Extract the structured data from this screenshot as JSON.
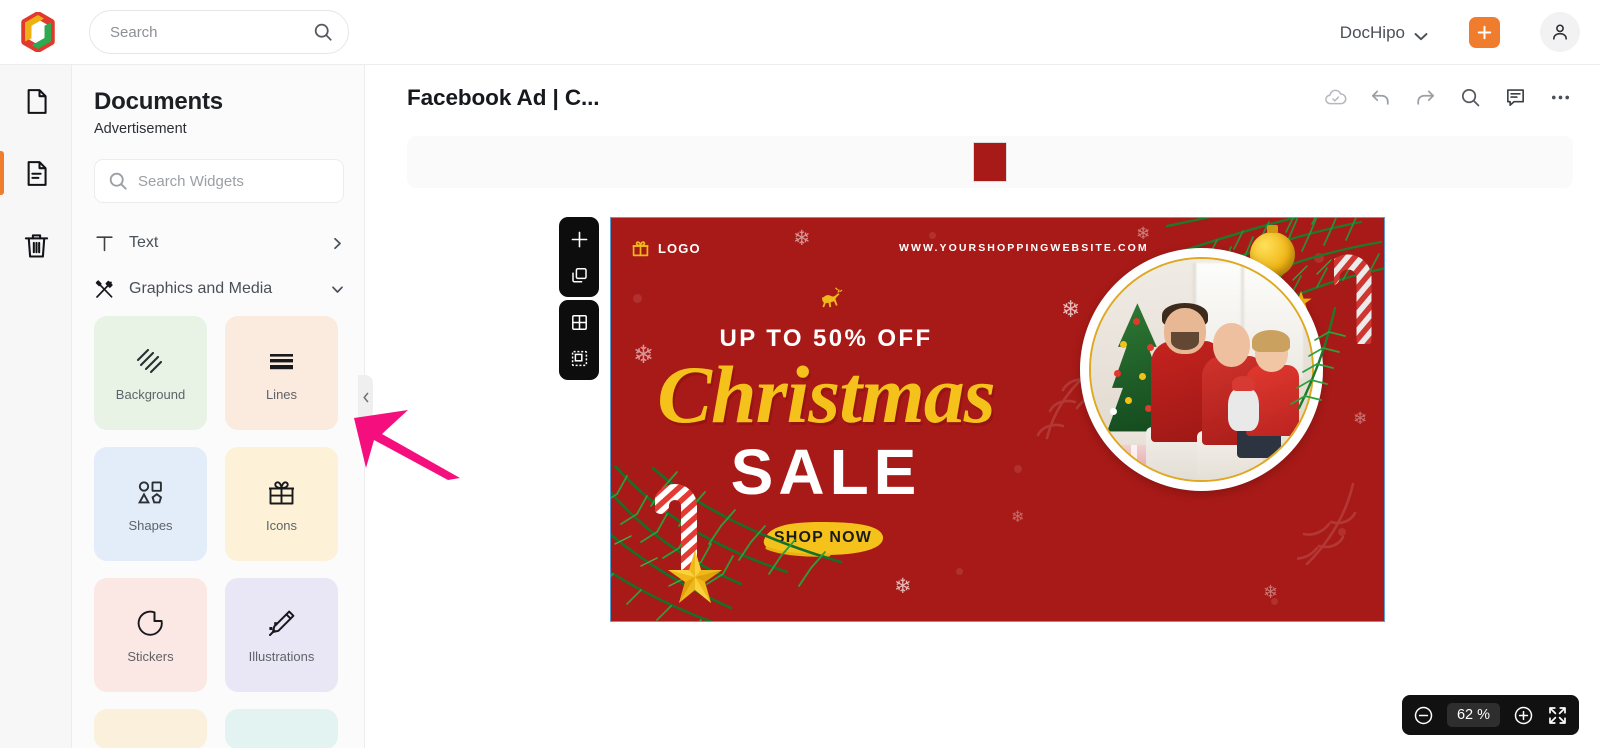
{
  "app": {
    "brand_icon": "dochipo-logo-icon",
    "account_label": "DocHipo",
    "account_chevron_icon": "chevron-down-icon",
    "create_button_icon": "plus-icon",
    "avatar_icon": "user-avatar-icon"
  },
  "search": {
    "placeholder": "Search",
    "value": "",
    "icon": "search-icon"
  },
  "rail": {
    "items": [
      {
        "name": "blank-page",
        "icon": "blank-page-icon",
        "active": false
      },
      {
        "name": "documents",
        "icon": "document-lines-icon",
        "active": true
      },
      {
        "name": "trash",
        "icon": "trash-icon",
        "active": false
      }
    ]
  },
  "panel": {
    "title": "Documents",
    "subtitle": "Advertisement",
    "widget_search": {
      "placeholder": "Search Widgets",
      "value": "",
      "icon": "search-icon"
    },
    "categories": [
      {
        "label": "Text",
        "icon": "text-t-icon",
        "arrow": "chevron-right-icon",
        "expanded": false
      },
      {
        "label": "Graphics and Media",
        "icon": "graphics-media-icon",
        "arrow": "chevron-down-icon",
        "expanded": true
      }
    ],
    "tiles": [
      {
        "label": "Background",
        "icon": "hatch-pattern-icon",
        "bg": "#e8f3e6",
        "partial": false
      },
      {
        "label": "Lines",
        "icon": "horizontal-lines-icon",
        "bg": "#fbeade",
        "partial": false
      },
      {
        "label": "Shapes",
        "icon": "shapes-icon",
        "bg": "#e3edfa",
        "partial": false
      },
      {
        "label": "Icons",
        "icon": "gift-box-icon",
        "bg": "#fdf2d8",
        "partial": false
      },
      {
        "label": "Stickers",
        "icon": "sticker-icon",
        "bg": "#fbe7e4",
        "partial": false
      },
      {
        "label": "Illustrations",
        "icon": "pencil-ruler-icon",
        "bg": "#e9e7f5",
        "partial": false
      },
      {
        "label": "",
        "icon": "",
        "bg": "#fbf0dc",
        "partial": true
      },
      {
        "label": "",
        "icon": "",
        "bg": "#e2f3f1",
        "partial": true
      }
    ],
    "collapse_icon": "chevron-left-icon"
  },
  "document": {
    "title": "Facebook Ad | C...",
    "tools": [
      {
        "name": "cloud-saved",
        "icon": "cloud-check-icon"
      },
      {
        "name": "undo",
        "icon": "undo-arrow-icon"
      },
      {
        "name": "redo",
        "icon": "redo-arrow-icon"
      },
      {
        "name": "find",
        "icon": "search-icon"
      },
      {
        "name": "comments",
        "icon": "comment-icon"
      },
      {
        "name": "more",
        "icon": "ellipsis-icon"
      }
    ],
    "pages": [
      {
        "index": 1,
        "selected": true,
        "color": "#a71a18"
      }
    ]
  },
  "canvas_toolbars": [
    {
      "name": "add-duplicate-toolbar",
      "buttons": [
        {
          "name": "add-page",
          "icon": "plus-icon"
        },
        {
          "name": "duplicate-page",
          "icon": "duplicate-icon"
        }
      ]
    },
    {
      "name": "grid-crop-toolbar",
      "buttons": [
        {
          "name": "grid-view",
          "icon": "grid-four-icon"
        },
        {
          "name": "crop-select",
          "icon": "crop-dashed-icon"
        }
      ]
    }
  ],
  "design": {
    "background_color": "#a81a17",
    "gold_color": "#f5c21b",
    "logo_label": "LOGO",
    "logo_icon": "gift-box-icon",
    "website_url": "WWW.YOURSHOPPINGWEBSITE.COM",
    "reindeer_icon": "reindeer-icon",
    "offer_text": "UP TO 50% OFF",
    "headline_script": "Christmas",
    "headline_bold": "SALE",
    "cta_label": "SHOP NOW",
    "photo_alt": "family-christmas-photo",
    "decorations": [
      "pine-branch-top-right",
      "gold-bauble-ornament",
      "candy-cane-top-right",
      "gold-star-top-right",
      "pine-branch-bottom-left",
      "candy-cane-bottom-left",
      "gold-star-bottom-left",
      "snowflakes",
      "leaf-doodles"
    ]
  },
  "zoom": {
    "decrease_icon": "minus-circle-icon",
    "value": "62 %",
    "increase_icon": "plus-circle-icon",
    "fullscreen_icon": "expand-arrows-icon"
  },
  "annotation": {
    "arrow_color": "#f50f7e",
    "points_at": "lines-tile"
  }
}
